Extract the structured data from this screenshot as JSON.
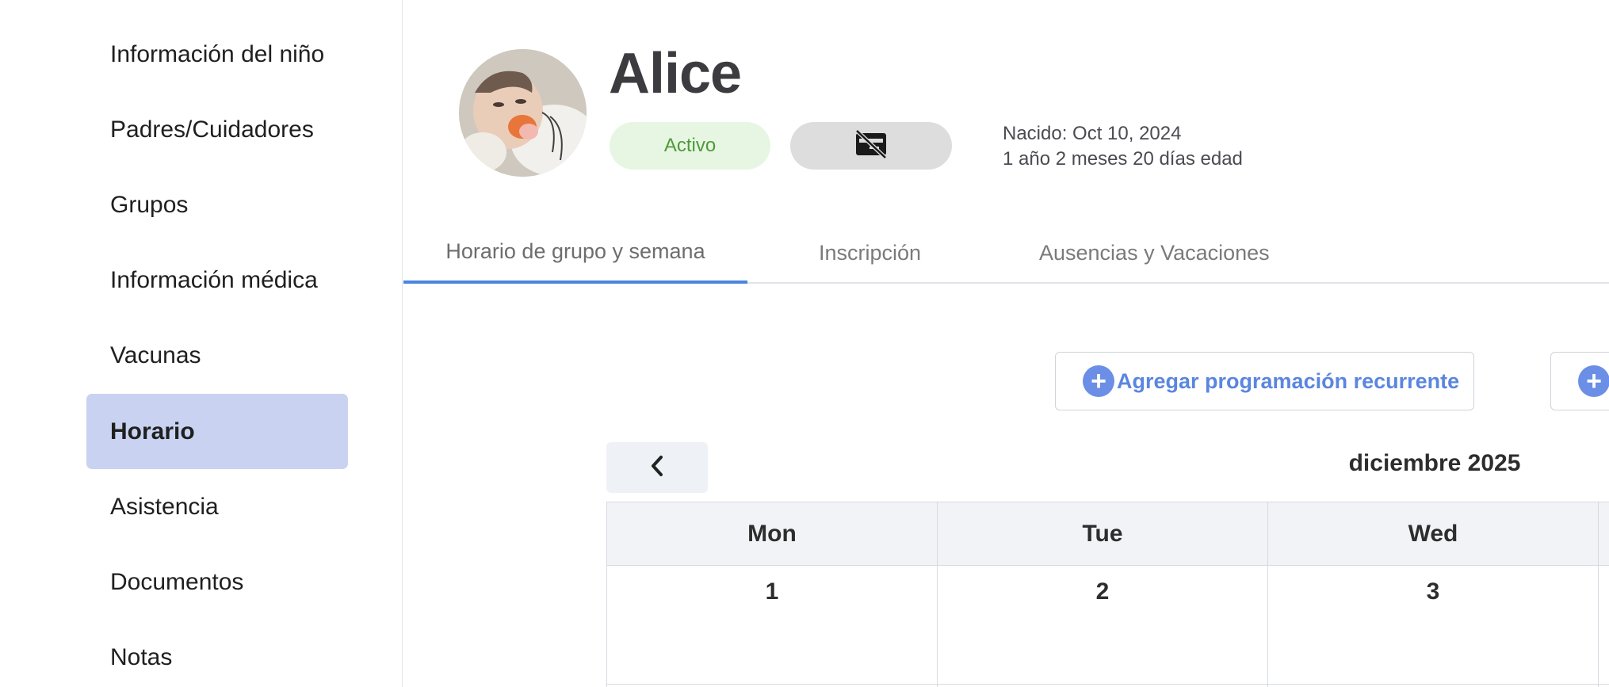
{
  "sidebar": {
    "items": [
      {
        "label": "Información del niño",
        "active": false
      },
      {
        "label": "Padres/Cuidadores",
        "active": false
      },
      {
        "label": "Grupos",
        "active": false
      },
      {
        "label": "Información médica",
        "active": false
      },
      {
        "label": "Vacunas",
        "active": false
      },
      {
        "label": "Horario",
        "active": true
      },
      {
        "label": "Asistencia",
        "active": false
      },
      {
        "label": "Documentos",
        "active": false
      },
      {
        "label": "Notas",
        "active": false
      }
    ]
  },
  "profile": {
    "name": "Alice",
    "status": "Activo",
    "status_color": "#4d9b3a",
    "card_icon": "no-card-icon",
    "born": "Nacido: Oct 10, 2024",
    "age": "1 año 2 meses 20 días edad"
  },
  "tabs": [
    {
      "label": "Horario de grupo y semana",
      "active": true
    },
    {
      "label": "Inscripción",
      "active": false
    },
    {
      "label": "Ausencias y Vacaciones",
      "active": false
    }
  ],
  "actions": {
    "add_recurring": "Agregar programación recurrente",
    "plus_icon": "plus-circle-icon"
  },
  "calendar": {
    "month": "diciembre 2025",
    "prev_icon": "chevron-left-icon",
    "days": [
      "Mon",
      "Tue",
      "Wed"
    ],
    "dates": [
      "1",
      "2",
      "3"
    ]
  },
  "colors": {
    "accent": "#4a86de",
    "sidebar_active": "#c9d3f1",
    "link_blue": "#5b86df"
  }
}
